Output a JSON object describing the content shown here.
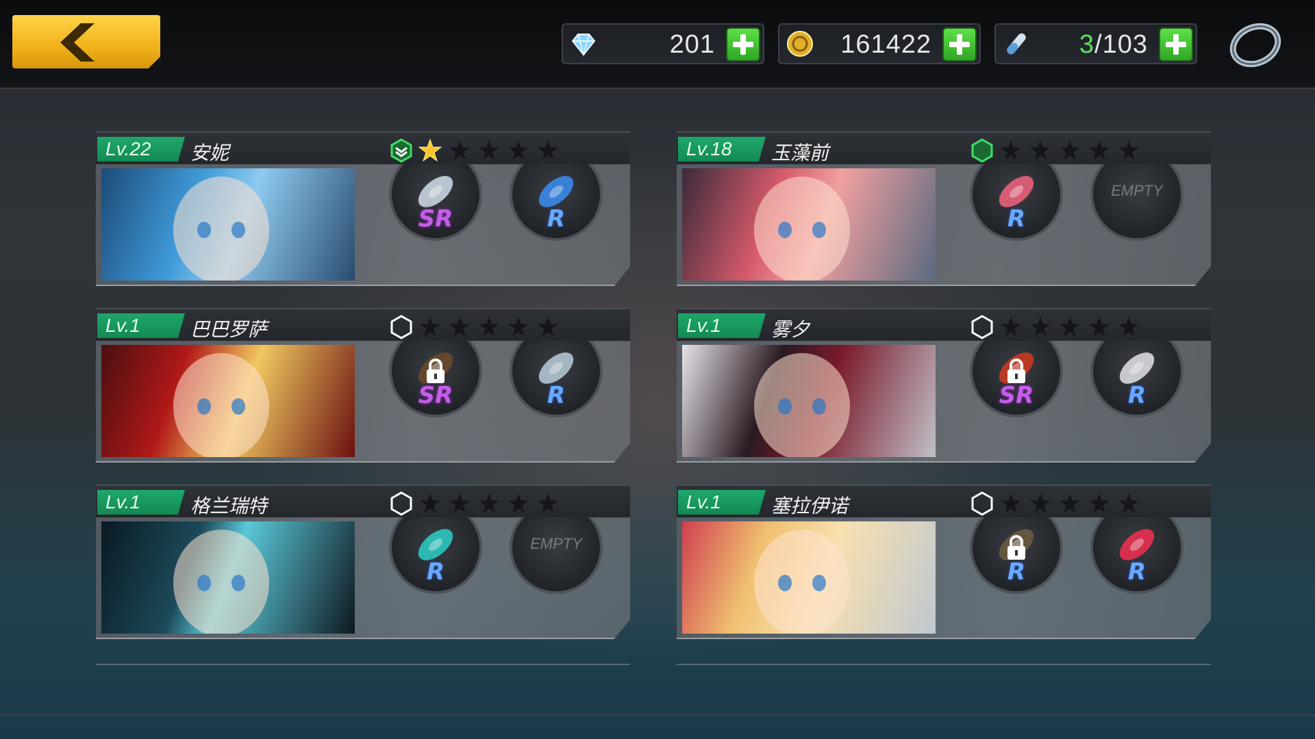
{
  "resources": {
    "crystals": {
      "value": "201",
      "icon": "crystal-icon"
    },
    "gold": {
      "value": "161422",
      "icon": "gold-coin-icon"
    },
    "stamina": {
      "current": "3",
      "max": "/103",
      "icon": "stamina-vial-icon"
    }
  },
  "characters": [
    {
      "level": "Lv.22",
      "name": "安妮",
      "stars_filled": 1,
      "stars_total": 5,
      "rank_icon": "rank-up-hex-icon",
      "slots": [
        {
          "rarity": "SR",
          "item": "potion-bottle"
        },
        {
          "rarity": "R",
          "item": "cat-staff"
        }
      ]
    },
    {
      "level": "Lv.18",
      "name": "玉藻前",
      "stars_filled": 0,
      "stars_total": 5,
      "rank_icon": "green-hex-icon",
      "slots": [
        {
          "rarity": "R",
          "item": "fox-mask"
        },
        {
          "empty_label": "EMPTY"
        }
      ]
    },
    {
      "level": "Lv.1",
      "name": "巴巴罗萨",
      "stars_filled": 0,
      "stars_total": 5,
      "rank_icon": "hex-icon",
      "slots": [
        {
          "rarity": "SR",
          "item": "flintlock",
          "locked": true
        },
        {
          "rarity": "R",
          "item": "fish"
        }
      ]
    },
    {
      "level": "Lv.1",
      "name": "雾夕",
      "stars_filled": 0,
      "stars_total": 5,
      "rank_icon": "hex-icon",
      "slots": [
        {
          "rarity": "SR",
          "item": "feather-fan",
          "locked": true
        },
        {
          "rarity": "R",
          "item": "rope-blade"
        }
      ]
    },
    {
      "level": "Lv.1",
      "name": "格兰瑞特",
      "stars_filled": 0,
      "stars_total": 5,
      "rank_icon": "hex-icon",
      "slots": [
        {
          "rarity": "R",
          "item": "curved-blade"
        },
        {
          "empty_label": "EMPTY"
        }
      ]
    },
    {
      "level": "Lv.1",
      "name": "塞拉伊诺",
      "stars_filled": 0,
      "stars_total": 5,
      "rank_icon": "hex-icon",
      "slots": [
        {
          "rarity": "R",
          "item": "anchor-staff",
          "locked": true
        },
        {
          "rarity": "R",
          "item": "red-blade"
        }
      ]
    }
  ],
  "colors": {
    "level_badge": "#1ea76a",
    "back_button": "#f1b21a",
    "plus_button": "#3fc02f",
    "sr": "#c45ee8",
    "r": "#6aa8ff"
  }
}
